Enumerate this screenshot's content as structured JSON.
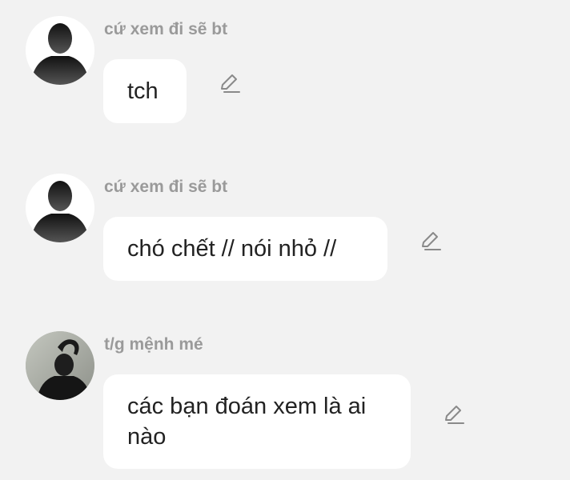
{
  "messages": [
    {
      "sender": "cứ xem đi sẽ bt",
      "text": "tch",
      "avatar": "silhouette-avatar-icon"
    },
    {
      "sender": "cứ xem đi sẽ bt",
      "text": "chó chết // nói nhỏ //",
      "avatar": "silhouette-avatar-icon"
    },
    {
      "sender": "t/g mệnh mé",
      "text": "các bạn đoán xem là ai nào",
      "avatar": "photo-avatar"
    }
  ],
  "icons": {
    "edit": "pencil-edit-icon"
  }
}
